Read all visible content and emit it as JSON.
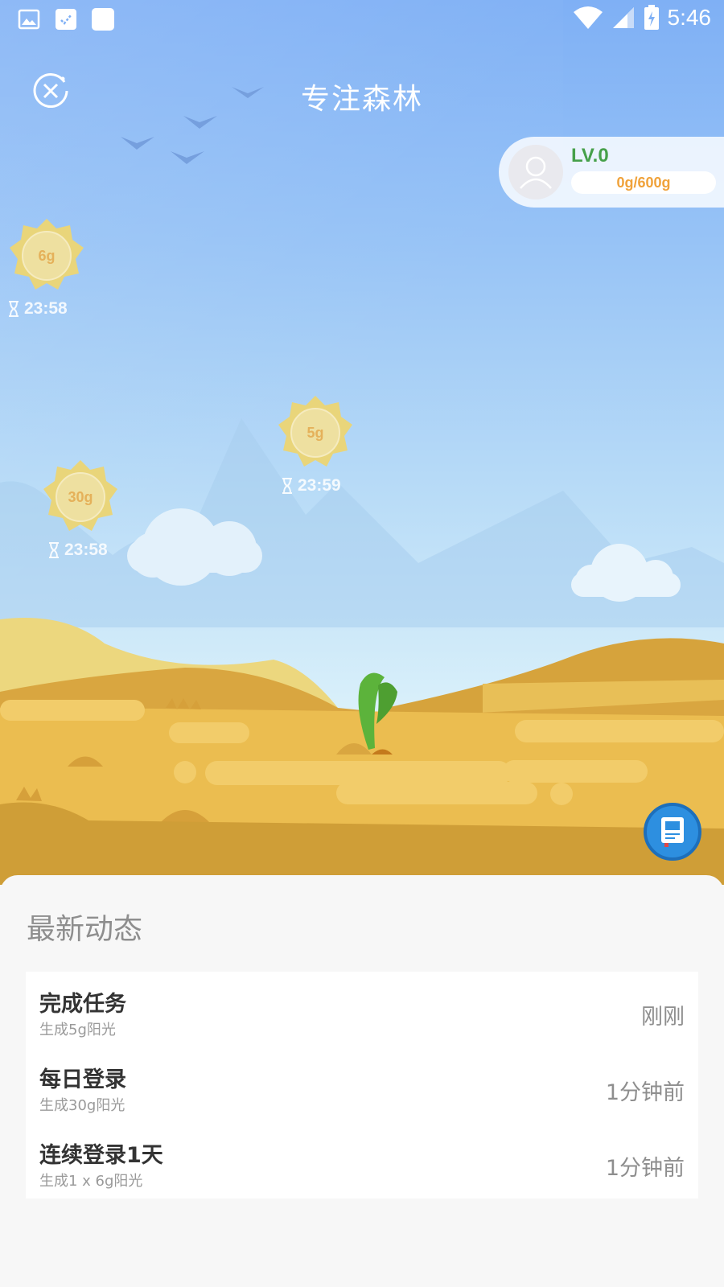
{
  "status_bar": {
    "time": "5:46",
    "left_icons": [
      "gallery-icon",
      "clock-icon",
      "app-icon"
    ],
    "right_icons": [
      "wifi-icon",
      "signal-icon",
      "battery-charging-icon"
    ]
  },
  "header": {
    "title": "专注森林",
    "close_icon": "close-timer-icon"
  },
  "level": {
    "label": "LV.0",
    "progress_text": "0g/600g",
    "progress_fraction": 0
  },
  "suns": [
    {
      "amount": "6g",
      "timer": "23:58"
    },
    {
      "amount": "5g",
      "timer": "23:59"
    },
    {
      "amount": "30g",
      "timer": "23:58"
    }
  ],
  "feed": {
    "title": "最新动态",
    "items": [
      {
        "title": "完成任务",
        "subtitle": "生成5g阳光",
        "time": "刚刚"
      },
      {
        "title": "每日登录",
        "subtitle": "生成30g阳光",
        "time": "1分钟前"
      },
      {
        "title": "连续登录1天",
        "subtitle": "生成1 x 6g阳光",
        "time": "1分钟前"
      }
    ]
  },
  "colors": {
    "sky_top": "#7fb0f5",
    "sand": "#ebbd50",
    "level_green": "#46a04a",
    "sun_yellow": "#e9d57a",
    "book_blue": "#2d8fe0"
  }
}
